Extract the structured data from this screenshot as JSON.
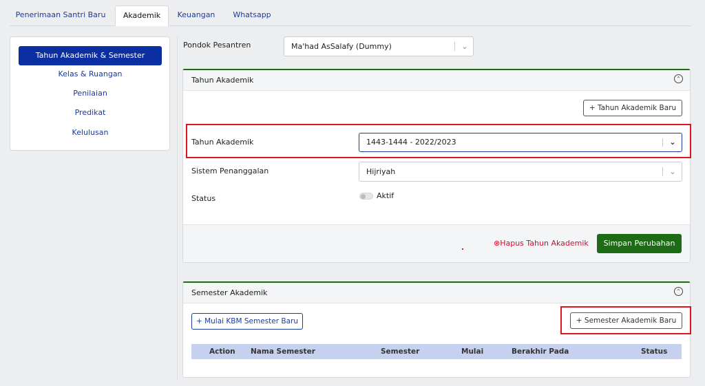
{
  "tabs": [
    {
      "label": "Penerimaan Santri Baru"
    },
    {
      "label": "Akademik"
    },
    {
      "label": "Keuangan"
    },
    {
      "label": "Whatsapp"
    }
  ],
  "sidebar": {
    "items": [
      {
        "label": "Tahun Akademik & Semester"
      },
      {
        "label": "Kelas & Ruangan"
      },
      {
        "label": "Penilaian"
      },
      {
        "label": "Predikat"
      },
      {
        "label": "Kelulusan"
      }
    ]
  },
  "pondok": {
    "label": "Pondok Pesantren",
    "value": "Ma'had AsSalafy (Dummy)"
  },
  "tahun_card": {
    "title": "Tahun Akademik",
    "add_button": "+ Tahun Akademik Baru",
    "tahun_label": "Tahun Akademik",
    "tahun_value": "1443-1444 - 2022/2023",
    "sistem_label": "Sistem Penanggalan",
    "sistem_value": "Hijriyah",
    "status_label": "Status",
    "status_toggle": "Aktif",
    "delete_link": "⊗Hapus Tahun Akademik",
    "save_button": "Simpan Perubahan"
  },
  "semester_card": {
    "title": "Semester Akademik",
    "start_button": "+ Mulai KBM Semester Baru",
    "add_button": "+ Semester Akademik Baru",
    "columns": [
      "Action",
      "Nama Semester",
      "Semester",
      "Mulai",
      "Berakhir Pada",
      "Status"
    ]
  },
  "icons": {
    "collapse": "chevron-up-circle-icon",
    "dropdown": "chevron-down-icon"
  },
  "colors": {
    "primary": "#0b2fa3",
    "success": "#1e6b16",
    "danger": "#c8102e",
    "highlight": "#e0141e"
  }
}
